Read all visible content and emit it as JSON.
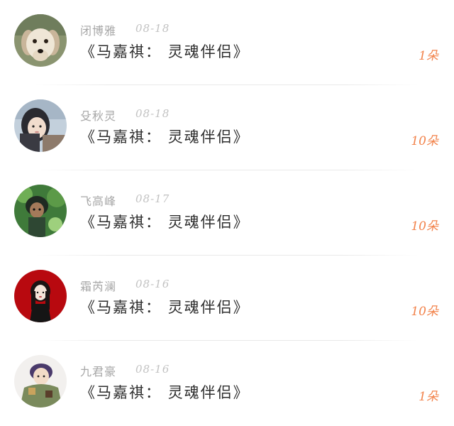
{
  "comments": [
    {
      "name": "闭博雅",
      "date": "08-18",
      "title": "《马嘉祺： 灵魂伴侣》",
      "count": "1朵",
      "avatar": "puppy-avatar"
    },
    {
      "name": "殳秋灵",
      "date": "08-18",
      "title": "《马嘉祺： 灵魂伴侣》",
      "count": "10朵",
      "avatar": "girl-avatar"
    },
    {
      "name": "飞高峰",
      "date": "08-17",
      "title": "《马嘉祺： 灵魂伴侣》",
      "count": "10朵",
      "avatar": "anime-forest-avatar"
    },
    {
      "name": "霜芮澜",
      "date": "08-16",
      "title": "《马嘉祺： 灵魂伴侣》",
      "count": "10朵",
      "avatar": "cartoon-girl-red-avatar"
    },
    {
      "name": "九君豪",
      "date": "08-16",
      "title": "《马嘉祺： 灵魂伴侣》",
      "count": "1朵",
      "avatar": "anime-boy-avatar"
    }
  ],
  "colors": {
    "name": "#a7a7a7",
    "date": "#c2c2c2",
    "title": "#2d2d2d",
    "count": "#f2824a"
  }
}
